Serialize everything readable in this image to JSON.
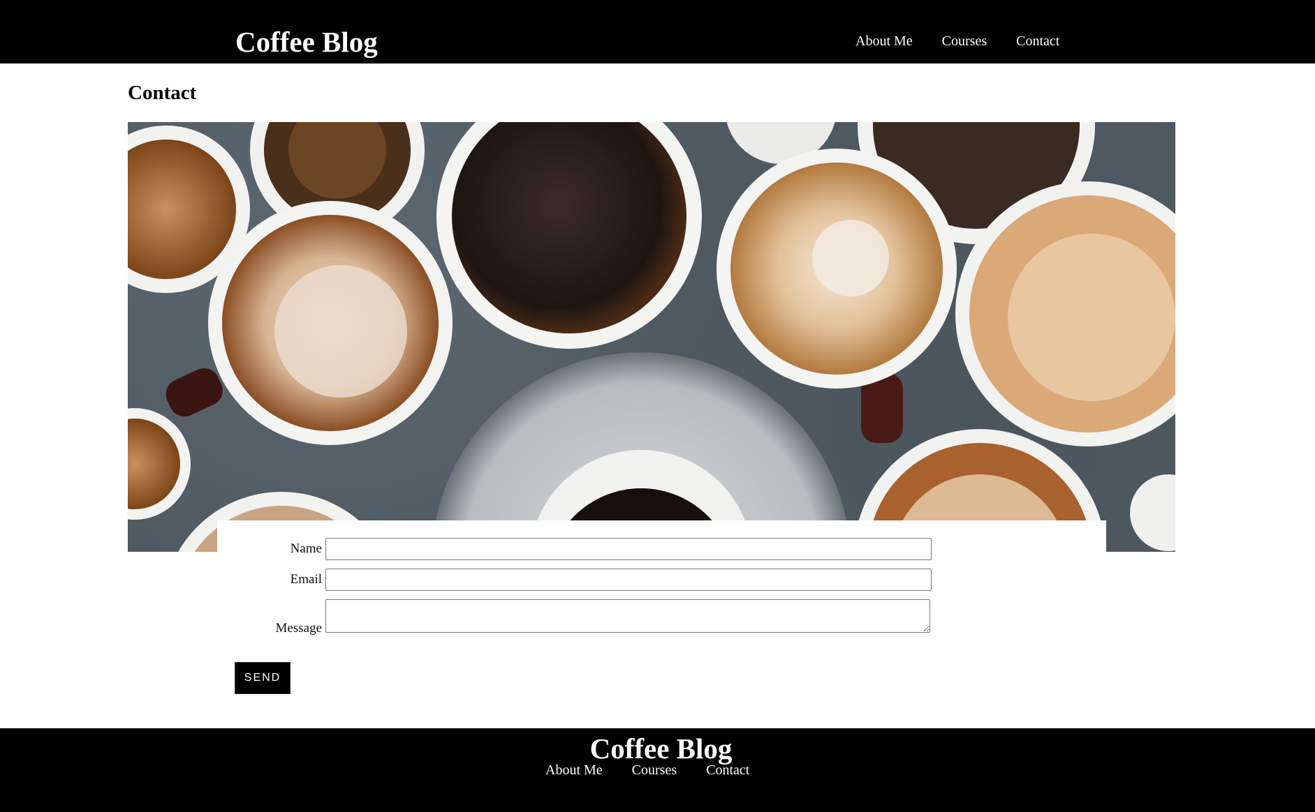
{
  "header": {
    "site_title": "Coffee Blog",
    "nav": [
      {
        "label": "About Me"
      },
      {
        "label": "Courses"
      },
      {
        "label": "Contact"
      }
    ]
  },
  "page": {
    "heading": "Contact"
  },
  "hero": {
    "alt": "Assorted coffee cups viewed from above"
  },
  "form": {
    "name_label": "Name",
    "name_value": "",
    "email_label": "Email",
    "email_value": "",
    "message_label": "Message",
    "message_value": "",
    "send_label": "SEND"
  },
  "footer": {
    "site_title": "Coffee Blog",
    "nav": [
      {
        "label": "About Me"
      },
      {
        "label": "Courses"
      },
      {
        "label": "Contact"
      }
    ]
  },
  "colors": {
    "header_bg": "#000000",
    "footer_bg": "#000000",
    "text_on_dark": "#ffffff",
    "button_bg": "#000000"
  }
}
